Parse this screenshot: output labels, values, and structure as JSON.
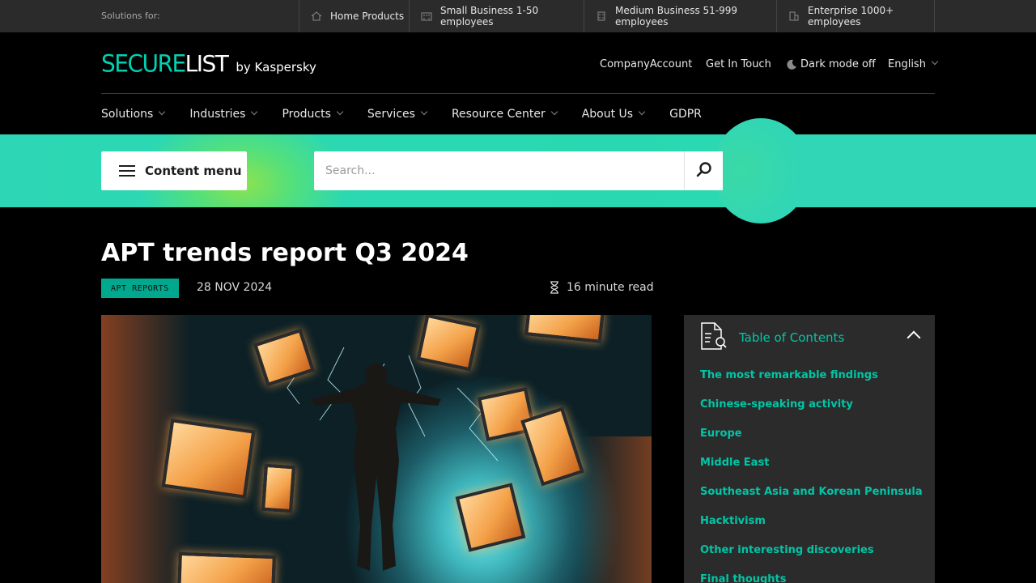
{
  "topbar": {
    "label": "Solutions for:",
    "segments": [
      {
        "label": "Home Products",
        "icon": "house-icon"
      },
      {
        "label": "Small Business 1-50 employees",
        "icon": "small-building-icon"
      },
      {
        "label": "Medium Business 51-999 employees",
        "icon": "medium-building-icon"
      },
      {
        "label": "Enterprise 1000+ employees",
        "icon": "enterprise-building-icon"
      }
    ]
  },
  "header": {
    "logo_secure": "SECURE",
    "logo_list": "LIST",
    "logo_by": "by Kaspersky",
    "links": {
      "company_account": "CompanyAccount",
      "get_in_touch": "Get In Touch",
      "dark_mode": "Dark mode off",
      "language": "English"
    }
  },
  "nav": {
    "items": [
      "Solutions",
      "Industries",
      "Products",
      "Services",
      "Resource Center",
      "About Us",
      "GDPR"
    ]
  },
  "toolbar": {
    "content_menu": "Content menu",
    "search_placeholder": "Search..."
  },
  "article": {
    "title": "APT trends report Q3 2024",
    "tag": "APT REPORTS",
    "date": "28 NOV 2024",
    "read_time": "16 minute read"
  },
  "toc": {
    "title": "Table of Contents",
    "items": [
      "The most remarkable findings",
      "Chinese-speaking activity",
      "Europe",
      "Middle East",
      "Southeast Asia and Korean Peninsula",
      "Hacktivism",
      "Other interesting discoveries",
      "Final thoughts"
    ]
  },
  "colors": {
    "accent": "#00c6a6",
    "band": "#2dd7b5",
    "tag_bg": "#00a88e",
    "topbar_bg": "#2b2b2b",
    "page_bg": "#000000"
  }
}
